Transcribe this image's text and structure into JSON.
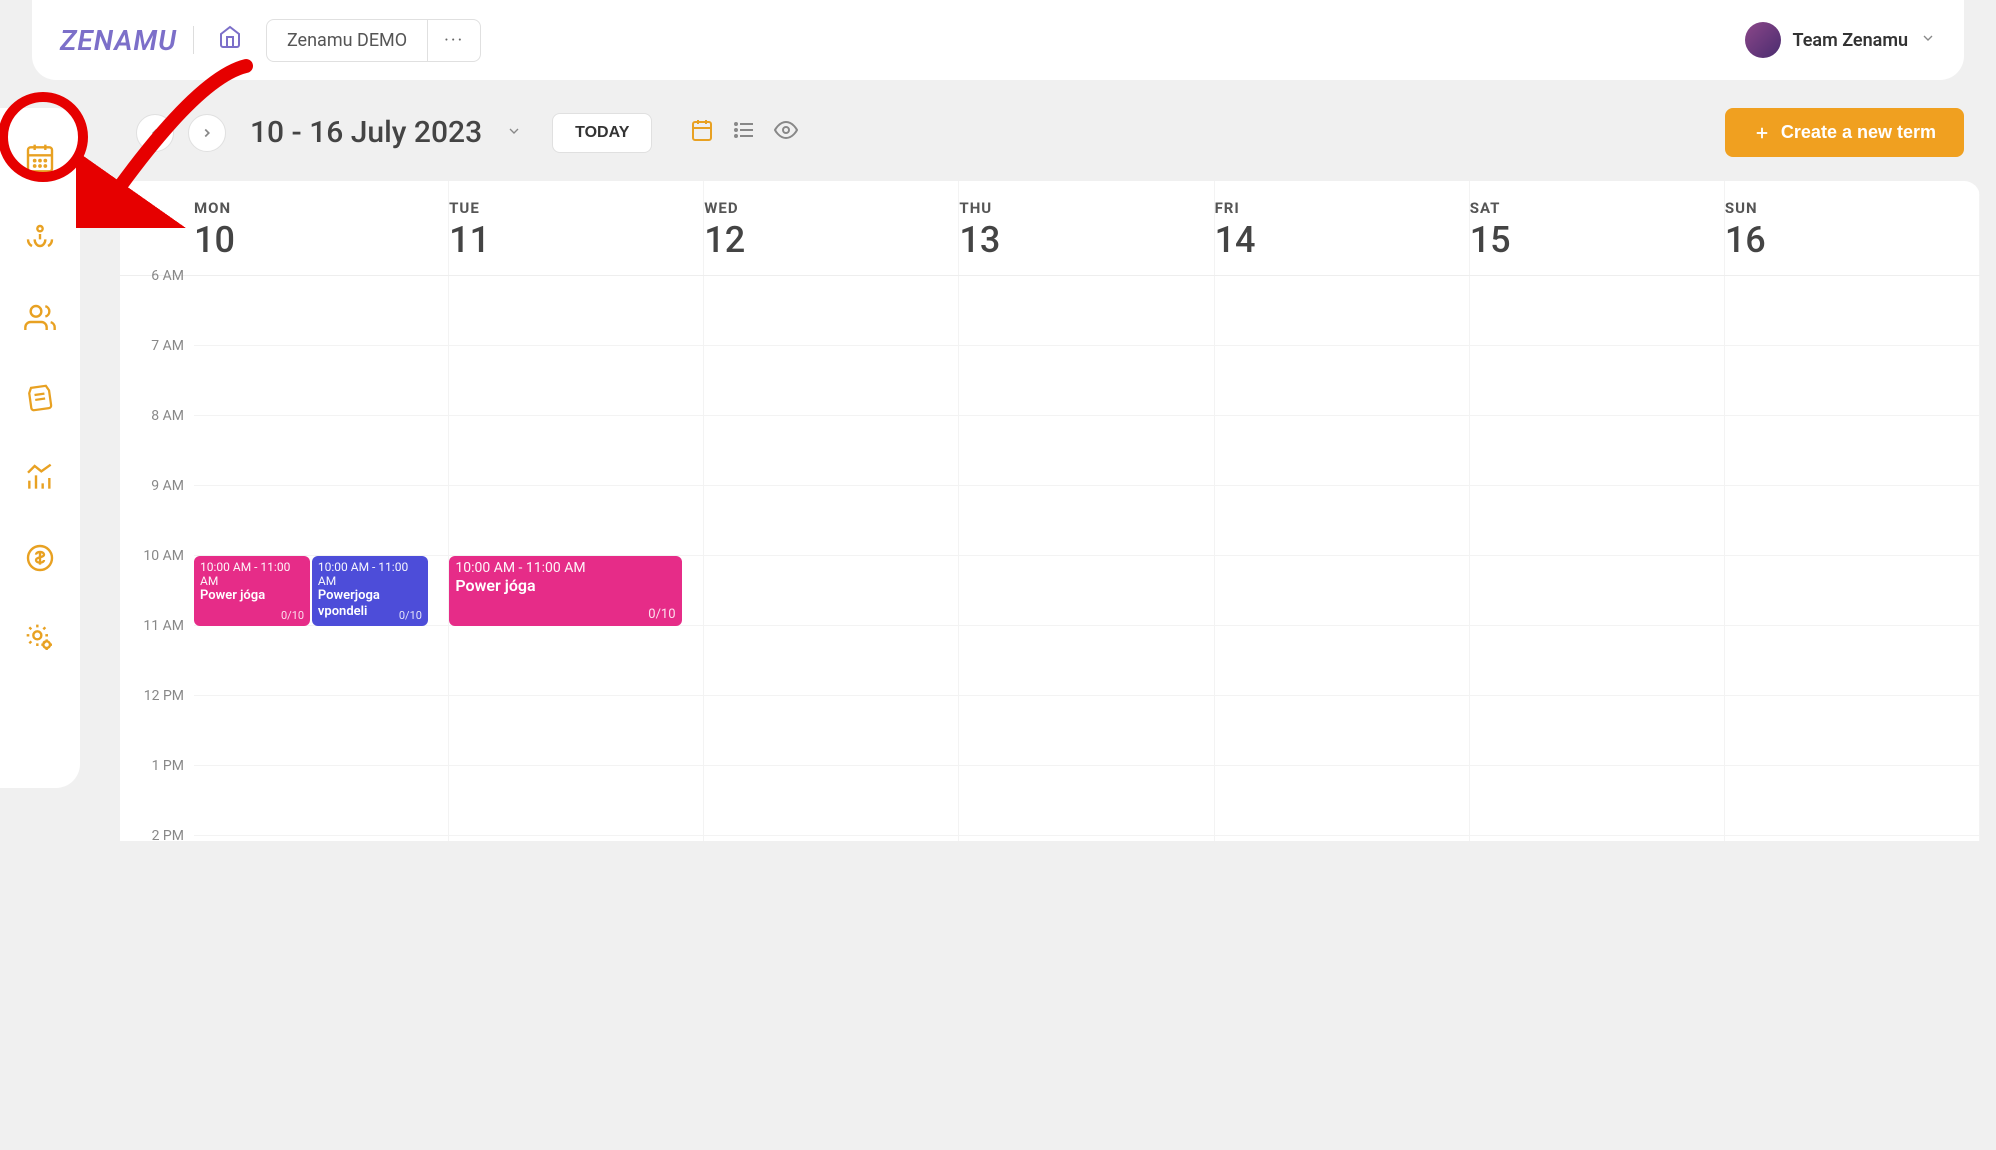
{
  "header": {
    "logo": "ZENAMU",
    "demo_label": "Zenamu DEMO",
    "user_name": "Team Zenamu"
  },
  "toolbar": {
    "date_range": "10 - 16 July 2023",
    "today_label": "TODAY",
    "create_label": "Create a new term"
  },
  "calendar": {
    "days": [
      {
        "name": "MON",
        "num": "10"
      },
      {
        "name": "TUE",
        "num": "11"
      },
      {
        "name": "WED",
        "num": "12"
      },
      {
        "name": "THU",
        "num": "13"
      },
      {
        "name": "FRI",
        "num": "14"
      },
      {
        "name": "SAT",
        "num": "15"
      },
      {
        "name": "SUN",
        "num": "16"
      }
    ],
    "hours": [
      "6 AM",
      "7 AM",
      "8 AM",
      "9 AM",
      "10 AM",
      "11 AM",
      "12 PM",
      "1 PM",
      "2 PM"
    ],
    "events": [
      {
        "time": "10:00 AM - 11:00 AM",
        "title": "Power jóga",
        "capacity": "0/10"
      },
      {
        "time": "10:00 AM - 11:00 AM",
        "title": "Powerjoga vpondeli",
        "capacity": "0/10"
      },
      {
        "time": "10:00 AM - 11:00 AM",
        "title": "Power jóga",
        "capacity": "0/10"
      }
    ]
  }
}
